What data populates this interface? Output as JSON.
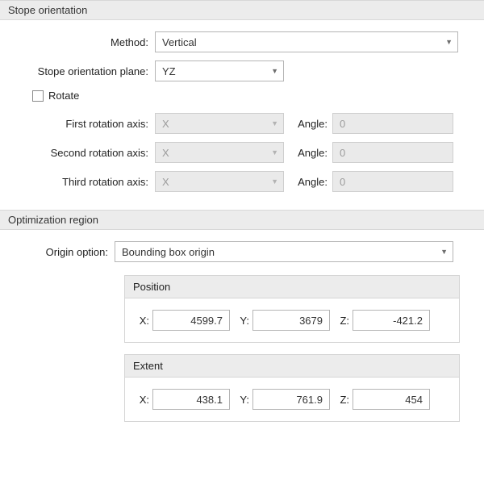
{
  "stopeOrientation": {
    "header": "Stope orientation",
    "methodLabel": "Method:",
    "methodValue": "Vertical",
    "planeLabel": "Stope orientation plane:",
    "planeValue": "YZ",
    "rotateLabel": "Rotate",
    "rotateChecked": false,
    "axes": [
      {
        "label": "First rotation axis:",
        "axisValue": "X",
        "angleLabel": "Angle:",
        "angleValue": "0"
      },
      {
        "label": "Second rotation axis:",
        "axisValue": "X",
        "angleLabel": "Angle:",
        "angleValue": "0"
      },
      {
        "label": "Third rotation axis:",
        "axisValue": "X",
        "angleLabel": "Angle:",
        "angleValue": "0"
      }
    ]
  },
  "optimizationRegion": {
    "header": "Optimization region",
    "originLabel": "Origin option:",
    "originValue": "Bounding box origin",
    "position": {
      "title": "Position",
      "xLabel": "X:",
      "x": "4599.7",
      "yLabel": "Y:",
      "y": "3679",
      "zLabel": "Z:",
      "z": "-421.2"
    },
    "extent": {
      "title": "Extent",
      "xLabel": "X:",
      "x": "438.1",
      "yLabel": "Y:",
      "y": "761.9",
      "zLabel": "Z:",
      "z": "454"
    }
  }
}
